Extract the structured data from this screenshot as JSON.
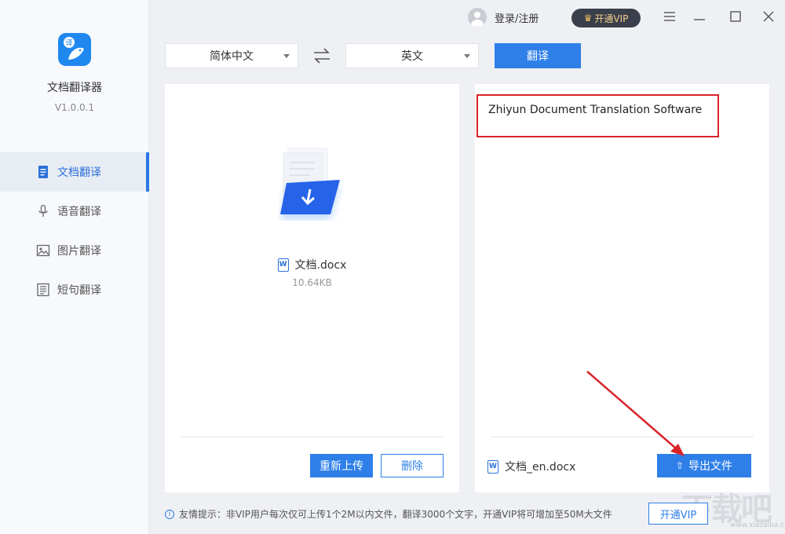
{
  "app": {
    "name": "文档翻译器",
    "version": "V1.0.0.1"
  },
  "sidebar": {
    "items": [
      {
        "label": "文档翻译",
        "icon": "document-icon",
        "active": true
      },
      {
        "label": "语音翻译",
        "icon": "microphone-icon",
        "active": false
      },
      {
        "label": "图片翻译",
        "icon": "image-icon",
        "active": false
      },
      {
        "label": "短句翻译",
        "icon": "text-list-icon",
        "active": false
      }
    ]
  },
  "topbar": {
    "login_label": "登录/注册",
    "vip_label": "开通VIP"
  },
  "languages": {
    "source": "简体中文",
    "target": "英文",
    "translate_label": "翻译"
  },
  "left_panel": {
    "file_name": "文档.docx",
    "file_size": "10.64KB",
    "reupload_label": "重新上传",
    "delete_label": "删除"
  },
  "right_panel": {
    "result_text": "Zhiyun Document Translation Software",
    "output_file_name": "文档_en.docx",
    "export_label": "导出文件"
  },
  "footer": {
    "tip": "友情提示：非VIP用户每次仅可上传1个2M以内文件，翻译3000个文字，开通VIP将可增加至50M大文件",
    "vip_label": "开通VIP"
  },
  "watermark": {
    "text": "下载吧",
    "sub": "www.xiazaiba.com"
  },
  "colors": {
    "accent": "#2e7fe8",
    "annotation": "#d9242b",
    "vip_bg": "#3a3f4b",
    "vip_text": "#f3d08a"
  }
}
